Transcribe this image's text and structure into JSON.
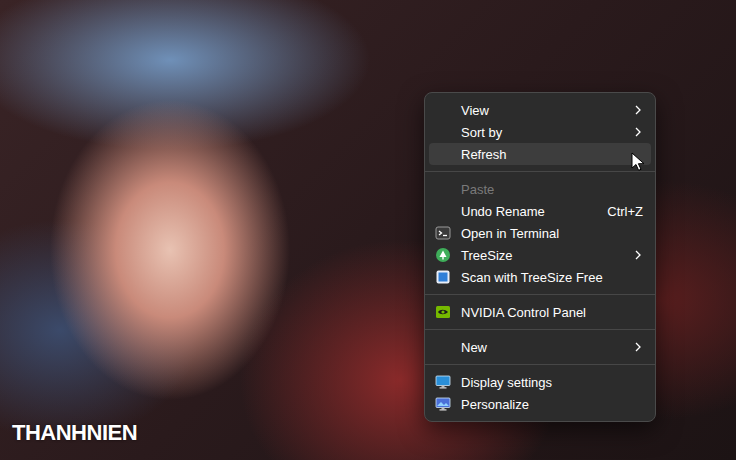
{
  "watermark": "THANHNIEN",
  "menu": {
    "items": [
      {
        "kind": "plain",
        "label": "View",
        "shortcut": "",
        "submenu": true,
        "selected": false,
        "disabled": false
      },
      {
        "kind": "plain",
        "label": "Sort by",
        "shortcut": "",
        "submenu": true,
        "selected": false,
        "disabled": false
      },
      {
        "kind": "plain",
        "label": "Refresh",
        "shortcut": "",
        "submenu": false,
        "selected": true,
        "disabled": false
      },
      {
        "kind": "separator"
      },
      {
        "kind": "plain",
        "label": "Paste",
        "shortcut": "",
        "submenu": false,
        "selected": false,
        "disabled": true
      },
      {
        "kind": "plain",
        "label": "Undo Rename",
        "shortcut": "Ctrl+Z",
        "submenu": false,
        "selected": false,
        "disabled": false
      },
      {
        "kind": "terminal",
        "label": "Open in Terminal",
        "shortcut": "",
        "submenu": false,
        "selected": false,
        "disabled": false
      },
      {
        "kind": "treesize",
        "label": "TreeSize",
        "shortcut": "",
        "submenu": true,
        "selected": false,
        "disabled": false
      },
      {
        "kind": "scan",
        "label": "Scan with TreeSize Free",
        "shortcut": "",
        "submenu": false,
        "selected": false,
        "disabled": false
      },
      {
        "kind": "separator"
      },
      {
        "kind": "nvidia",
        "label": "NVIDIA Control Panel",
        "shortcut": "",
        "submenu": false,
        "selected": false,
        "disabled": false
      },
      {
        "kind": "separator"
      },
      {
        "kind": "plain",
        "label": "New",
        "shortcut": "",
        "submenu": true,
        "selected": false,
        "disabled": false
      },
      {
        "kind": "separator"
      },
      {
        "kind": "display",
        "label": "Display settings",
        "shortcut": "",
        "submenu": false,
        "selected": false,
        "disabled": false
      },
      {
        "kind": "personalize",
        "label": "Personalize",
        "shortcut": "",
        "submenu": false,
        "selected": false,
        "disabled": false
      }
    ]
  }
}
